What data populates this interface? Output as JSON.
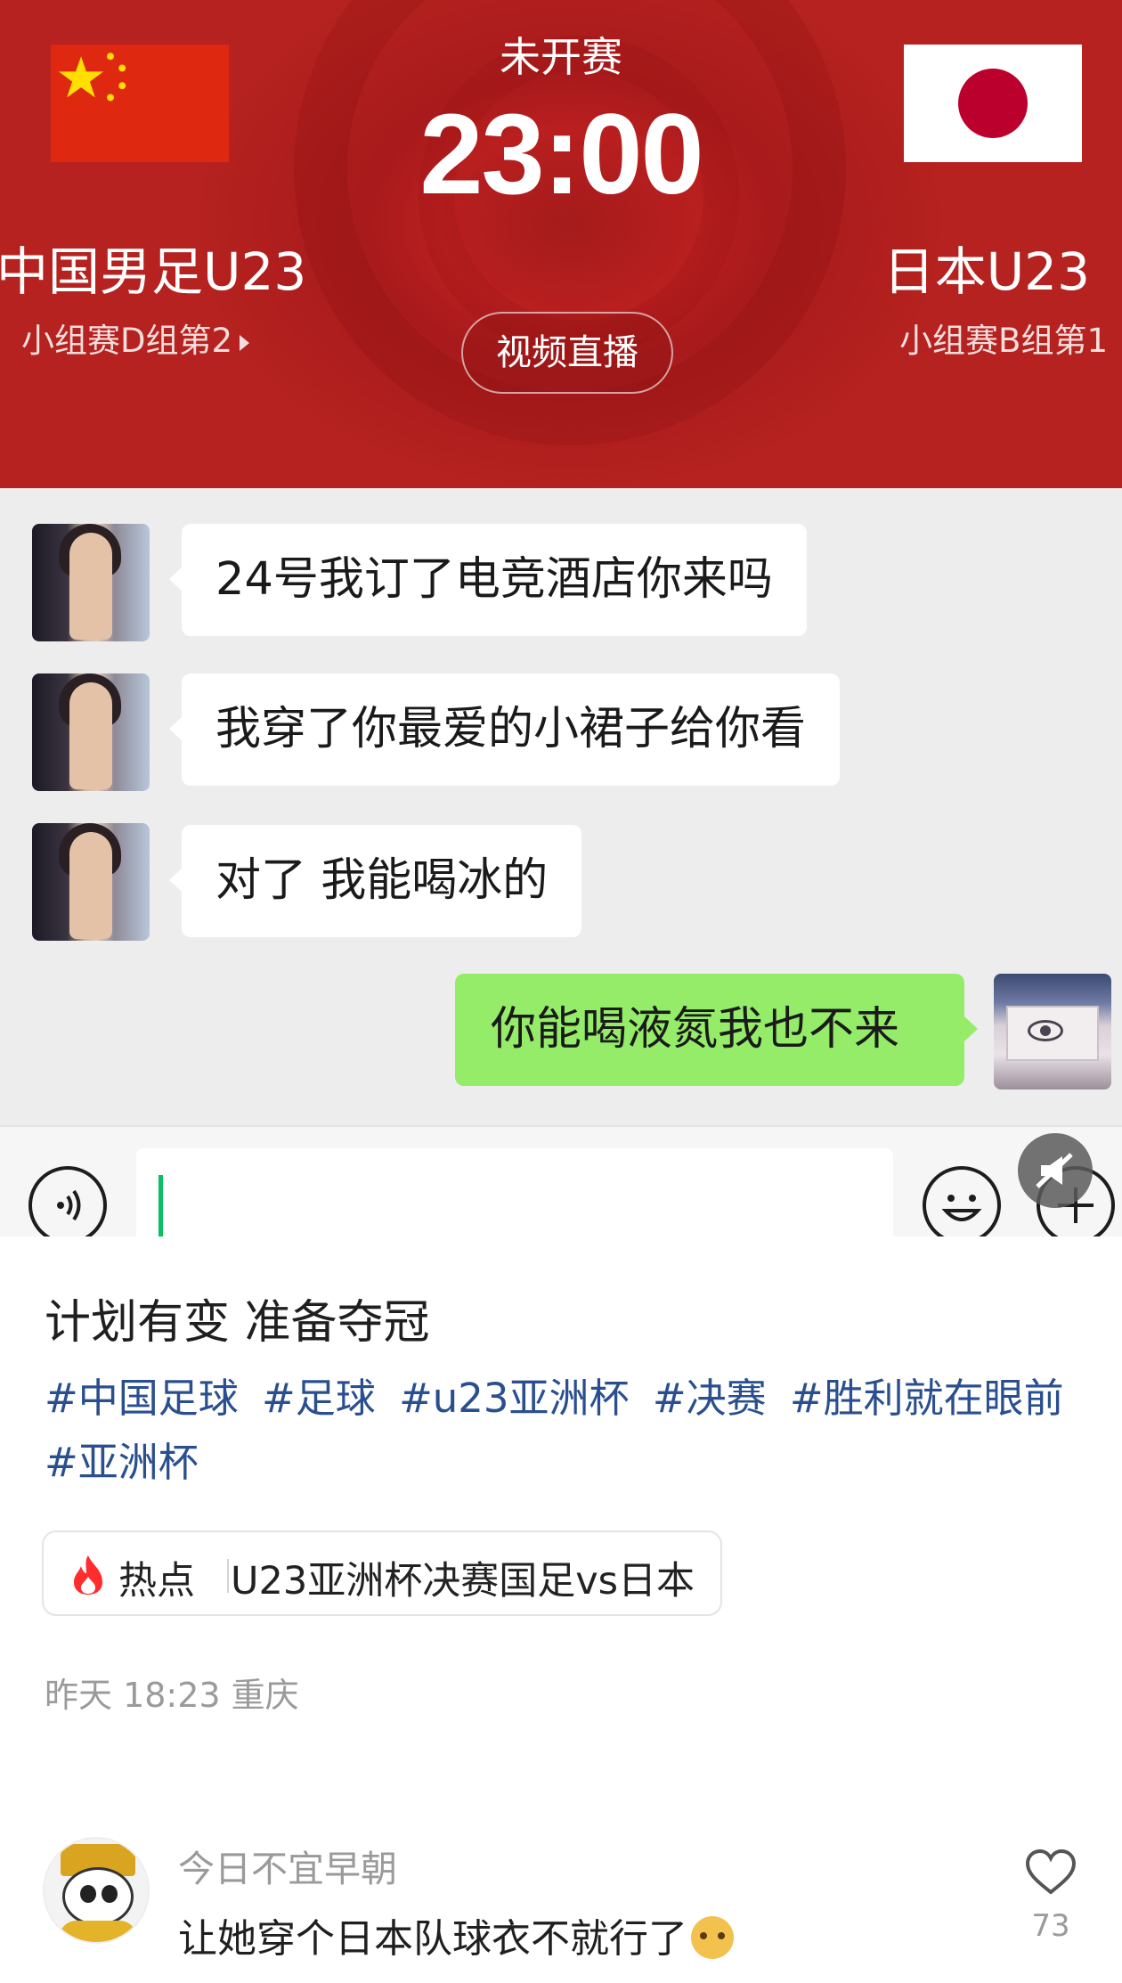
{
  "match": {
    "status": "未开赛",
    "time": "23:00",
    "home_team": "中国男足U23",
    "home_group": "小组赛D组第2",
    "away_team": "日本U23",
    "away_group": "小组赛B组第1",
    "live_button": "视频直播"
  },
  "chat": {
    "messages": [
      {
        "from": "other",
        "text": "24号我订了电竞酒店你来吗"
      },
      {
        "from": "other",
        "text": "我穿了你最爱的小裙子给你看"
      },
      {
        "from": "other",
        "text": "对了 我能喝冰的"
      },
      {
        "from": "me",
        "text": "你能喝液氮我也不来"
      }
    ],
    "colors": {
      "incoming_bubble": "#ffffff",
      "outgoing_bubble": "#95ec69",
      "caret": "#07c160"
    }
  },
  "post": {
    "title": "计划有变 准备夺冠",
    "tags": [
      "#中国足球",
      "#足球",
      "#u23亚洲杯",
      "#决赛",
      "#胜利就在眼前",
      "#亚洲杯"
    ],
    "hot": {
      "label": "热点",
      "topic": "U23亚洲杯决赛国足vs日本"
    },
    "meta": "昨天 18:23 重庆"
  },
  "comment": {
    "user": "今日不宜早朝",
    "text": "让她穿个日本队球衣不就行了",
    "likes": "73"
  },
  "icons": {
    "voice": "voice-icon",
    "emoji": "emoji-icon",
    "plus": "plus-icon",
    "mute": "mute-icon",
    "flame": "flame-icon",
    "like": "heart-icon"
  }
}
